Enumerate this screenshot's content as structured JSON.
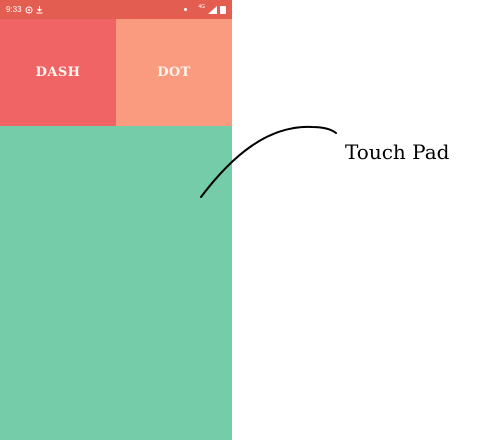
{
  "status_bar": {
    "time": "9:33",
    "network_label": "4G"
  },
  "buttons": {
    "dash_label": "DASH",
    "dot_label": "DOT"
  },
  "annotation": {
    "label": "Touch Pad"
  },
  "colors": {
    "status_bar": "#e35d50",
    "dash_button": "#f06466",
    "dot_button": "#fa9a7e",
    "touch_pad": "#74cca9"
  }
}
